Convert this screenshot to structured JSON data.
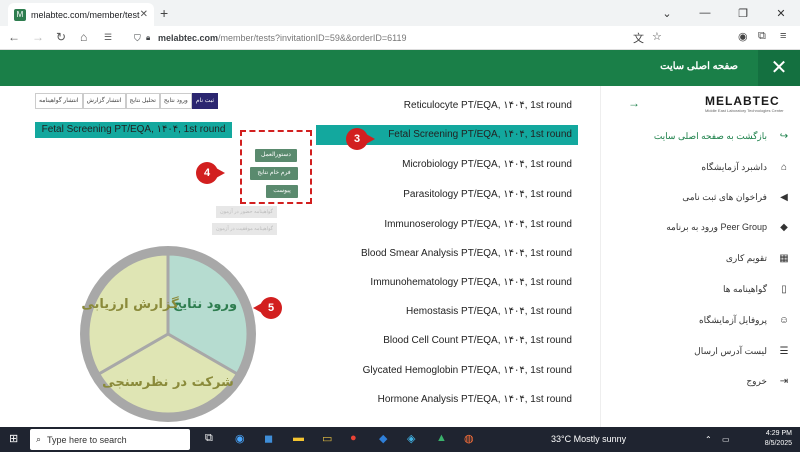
{
  "browser": {
    "tab_title": "melabtec.com/member/tests?i",
    "url_domain": "melabtec.com",
    "url_path": "/member/tests?invitationID=59&&orderID=6119"
  },
  "header": {
    "home_text": "صفحه اصلی سایت"
  },
  "sidebar": {
    "logo": "MELABTEC",
    "logo_sub": "Middle East Laboratory Technologies Center",
    "items": [
      {
        "label": "بازگشت به صفحه اصلی سایت",
        "icon": "back-arrow-icon"
      },
      {
        "label": "داشبرد آزمایشگاه",
        "icon": "home-icon"
      },
      {
        "label": "فراخوان های ثبت نامی",
        "icon": "megaphone-icon"
      },
      {
        "label": "ورود به برنامه Peer Group",
        "icon": "tag-icon"
      },
      {
        "label": "تقویم کاری",
        "icon": "calendar-icon"
      },
      {
        "label": "گواهینامه ها",
        "icon": "book-icon"
      },
      {
        "label": "پروفایل آزمایشگاه",
        "icon": "user-icon"
      },
      {
        "label": "لیست آدرس ارسال",
        "icon": "list-icon"
      },
      {
        "label": "خروج",
        "icon": "logout-icon"
      }
    ]
  },
  "tests": [
    "Reticulocyte PT/EQA, ۱۴۰۴, 1st round",
    "Fetal Screening PT/EQA, ۱۴۰۴, 1st round",
    "Microbiology PT/EQA, ۱۴۰۴, 1st round",
    "Parasitology PT/EQA, ۱۴۰۴, 1st round",
    "Immunoserology PT/EQA, ۱۴۰۴, 1st round",
    "Blood Smear Analysis PT/EQA, ۱۴۰۴, 1st round",
    "Immunohematology PT/EQA, ۱۴۰۴, 1st round",
    "Hemostasis PT/EQA, ۱۴۰۴, 1st round",
    "Blood Cell Count PT/EQA, ۱۴۰۴, 1st round",
    "Glycated Hemoglobin PT/EQA, ۱۴۰۴, 1st round",
    "Hormone Analysis PT/EQA, ۱۴۰۴, 1st round"
  ],
  "detail": {
    "tabs": [
      "ثبت نام",
      "ورود نتایج",
      "تحلیل نتایج",
      "انتشار گزارش",
      "انتشار گواهینامه"
    ],
    "selected_test": "Fetal Screening PT/EQA, ۱۴۰۴, 1st round",
    "buttons": [
      "دستورالعمل",
      "فرم خام نتایج",
      "پیوست"
    ],
    "disabled": [
      "گواهینامه حضور در آزمون",
      "گواهینامه موفقیت در آزمون"
    ]
  },
  "cycle": {
    "segments": [
      "ورود نتایج",
      "شرکت در نظرسنجی",
      "گزارش ارزیابی"
    ]
  },
  "markers": [
    "3",
    "4",
    "5"
  ],
  "taskbar": {
    "search_placeholder": "Type here to search",
    "weather": "33°C  Mostly sunny",
    "time": "4:29 PM",
    "date": "8/5/2025"
  }
}
